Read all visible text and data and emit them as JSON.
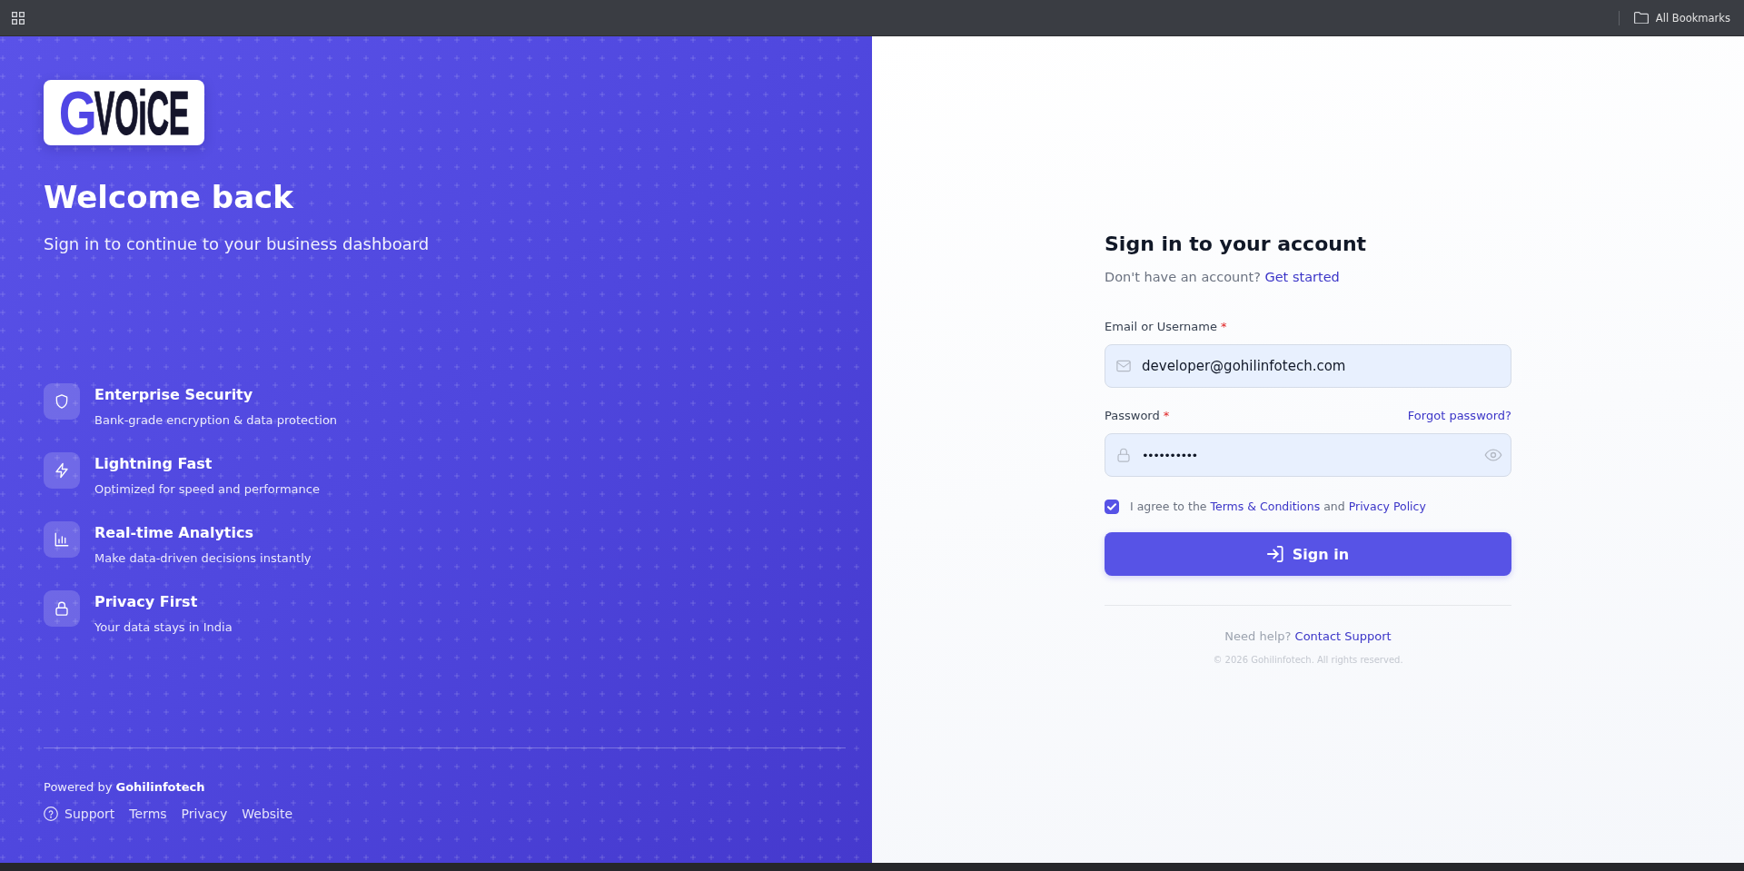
{
  "browser_toolbar": {
    "bookmarks": "All Bookmarks"
  },
  "brand_panel": {
    "logo": {
      "mark": "G",
      "wordmark": "VOiCE"
    },
    "heading": "Welcome back",
    "subheading": "Sign in to continue to your business dashboard",
    "features": [
      {
        "title": "Enterprise Security",
        "description": "Bank-grade encryption & data protection"
      },
      {
        "title": "Lightning Fast",
        "description": "Optimized for speed and performance"
      },
      {
        "title": "Real-time Analytics",
        "description": "Make data-driven decisions instantly"
      },
      {
        "title": "Privacy First",
        "description": "Your data stays in India"
      }
    ],
    "footer": {
      "powered_by": "Powered by **Gohilinfotech**",
      "links": [
        "Support",
        "Terms",
        "Privacy",
        "Website"
      ]
    }
  },
  "sign_in": {
    "title": "Sign in to your account",
    "prompt": "Don't have an account?",
    "prompt_link": "Get started",
    "fields": [
      {
        "kind": "email",
        "label": "Email or Username",
        "required_mark": "*",
        "value": "developer@gohilinfotech.com"
      },
      {
        "kind": "password",
        "label": "Password",
        "required_mark": "*",
        "link": "Forgot password?",
        "value": "••••••••••"
      }
    ],
    "agreement": {
      "checked": true,
      "before": "I agree to the",
      "terms_link": "Terms & Conditions",
      "between": "and",
      "privacy_link": "Privacy Policy"
    },
    "submit": "Sign in",
    "help": "Need help?",
    "help_link": "Contact Support",
    "copyright": "© 2026 Gohilinfotech. All rights reserved."
  }
}
